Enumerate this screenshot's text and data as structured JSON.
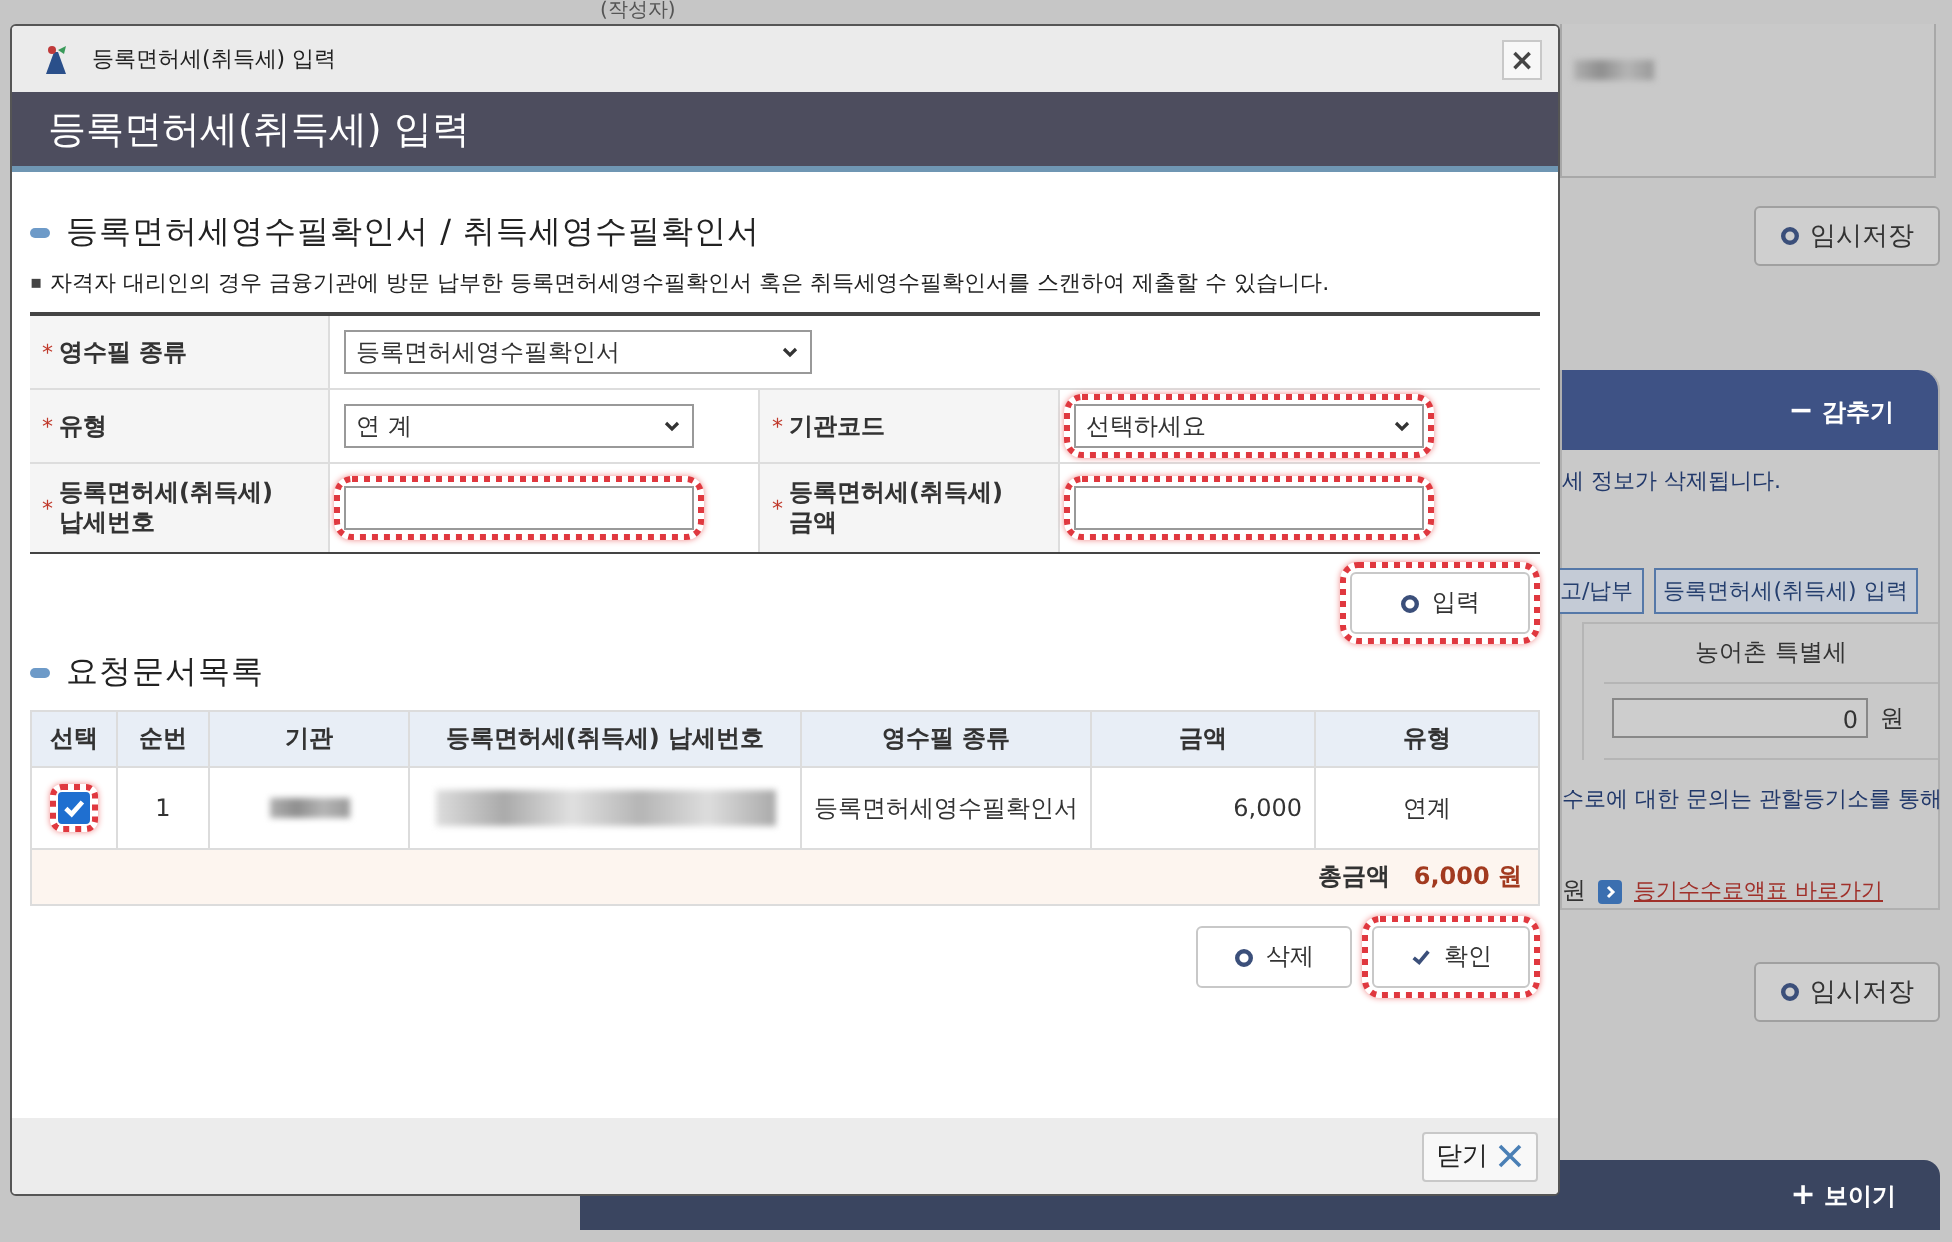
{
  "background_page": {
    "author_label": "(작성자)",
    "save_button": "임시저장",
    "panel": {
      "toggle_symbol": "−",
      "toggle_label": "감추기",
      "notice": "세 정보가 삭제됩니다.",
      "buttons": [
        "고/납부",
        "등록면허세(취득세) 입력"
      ],
      "column_header": "농어촌 특별세",
      "amount_value": "0",
      "amount_unit": "원",
      "inquiry_text": "수로에 대한 문의는 관할등기소를 통해",
      "unit_text": "원",
      "link": "등기수수료액표 바로가기"
    },
    "second_save_button": "임시저장",
    "bottom_bar": {
      "toggle_symbol": "+",
      "toggle_label": "보이기"
    }
  },
  "dialog": {
    "window_title": "등록면허세(취득세) 입력",
    "close_symbol": "×",
    "header": "등록면허세(취득세) 입력",
    "section_title": "등록면허세영수필확인서 / 취득세영수필확인서",
    "note_bullet": "▪",
    "note": "자격자 대리인의 경우 금융기관에 방문 납부한 등록면허세영수필확인서 혹은 취득세영수필확인서를 스캔하여 제출할 수 있습니다.",
    "form_rows": [
      [
        {
          "kind": "select",
          "required_mark": "*",
          "label": "영수필 종류",
          "value": "등록면허세영수필확인서",
          "highlighted": false
        }
      ],
      [
        {
          "kind": "select",
          "required_mark": "*",
          "label": "유형",
          "value": "연 계",
          "highlighted": false
        },
        {
          "kind": "select",
          "required_mark": "*",
          "label": "기관코드",
          "value": "선택하세요",
          "highlighted": true
        }
      ],
      [
        {
          "kind": "input",
          "required_mark": "*",
          "label": "등록면허세(취득세) 납세번호",
          "highlighted": true
        },
        {
          "kind": "input",
          "required_mark": "*",
          "label": "등록면허세(취득세) 금액",
          "highlighted": true
        }
      ]
    ],
    "input_button": {
      "label": "입력",
      "highlighted": true
    },
    "list_title": "요청문서목록",
    "table": {
      "columns": [
        "선택",
        "순번",
        "기관",
        "등록면허세(취득세) 납세번호",
        "영수필 종류",
        "금액",
        "유형"
      ],
      "rows": [
        {
          "checked": true,
          "highlighted": true,
          "number": "1",
          "receipt_type": "등록면허세영수필확인서",
          "amount": "6,000",
          "type": "연계"
        }
      ],
      "total_label": "총금액",
      "total_value": "6,000 원"
    },
    "delete_button": {
      "label": "삭제",
      "highlighted": false
    },
    "confirm_button": {
      "label": "확인",
      "highlighted": true
    },
    "close_button": {
      "label": "닫기"
    }
  }
}
